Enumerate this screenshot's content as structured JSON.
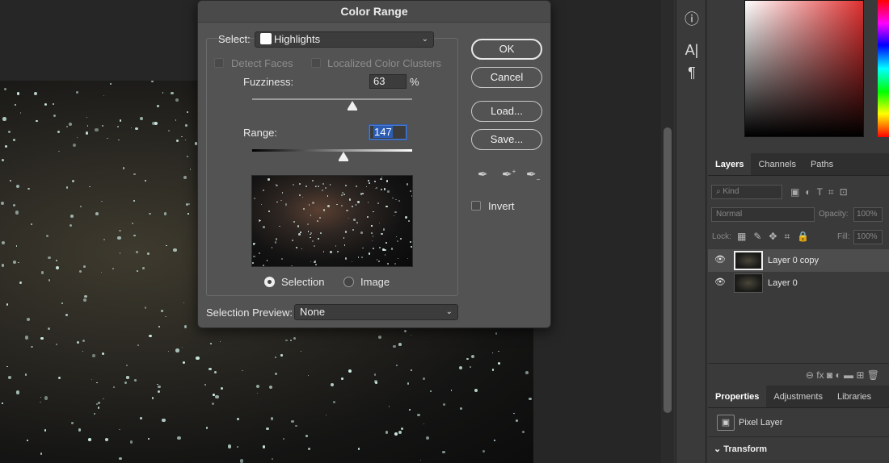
{
  "dialog": {
    "title": "Color Range",
    "select_label": "Select:",
    "select_value": "Highlights",
    "detect_faces": "Detect Faces",
    "localized_clusters": "Localized Color Clusters",
    "fuzziness_label": "Fuzziness:",
    "fuzziness_value": "63",
    "fuzziness_unit": "%",
    "range_label": "Range:",
    "range_value": "147",
    "radio_selection": "Selection",
    "radio_image": "Image",
    "preview_label": "Selection Preview:",
    "preview_value": "None",
    "buttons": {
      "ok": "OK",
      "cancel": "Cancel",
      "load": "Load...",
      "save": "Save..."
    },
    "invert_label": "Invert"
  },
  "toolbar": {
    "info_icon": "ⓘ",
    "character_icon": "A|",
    "paragraph_icon": "¶"
  },
  "layers_panel": {
    "tabs": [
      "Layers",
      "Channels",
      "Paths"
    ],
    "kind_label": "Kind",
    "blend_mode": "Normal",
    "opacity_label": "Opacity:",
    "opacity_value": "100%",
    "lock_label": "Lock:",
    "fill_label": "Fill:",
    "fill_value": "100%",
    "layers": [
      {
        "name": "Layer 0 copy",
        "selected": true
      },
      {
        "name": "Layer 0",
        "selected": false
      }
    ],
    "footer_icons": "⊖  fx  ◙  ◐  ▬  ⊞  🗑"
  },
  "properties_panel": {
    "tabs": [
      "Properties",
      "Adjustments",
      "Libraries"
    ],
    "layer_type": "Pixel Layer",
    "transform_label": "Transform"
  },
  "colors": {
    "accent": "#2b5db5",
    "dialog_bg": "#535353",
    "panel_bg": "#3a3a3a"
  }
}
